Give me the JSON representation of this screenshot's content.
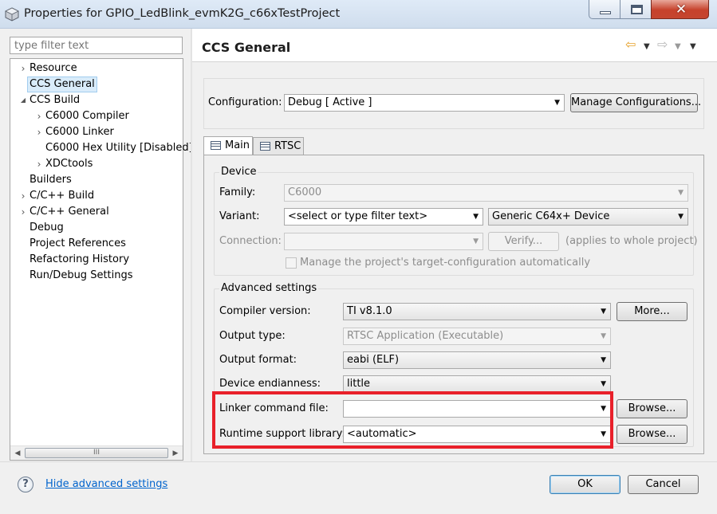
{
  "window": {
    "title": "Properties for GPIO_LedBlink_evmK2G_c66xTestProject",
    "minimize_glyph": "—",
    "maximize_glyph": "□",
    "close_glyph": "✕"
  },
  "filter": {
    "placeholder": "type filter text"
  },
  "tree": {
    "items": [
      {
        "label": "Resource",
        "expander": "›",
        "selected": false
      },
      {
        "label": "CCS General",
        "expander": "",
        "selected": true
      },
      {
        "label": "CCS Build",
        "expander": "◢",
        "selected": false
      },
      {
        "label": "C6000 Compiler",
        "expander": "›",
        "selected": false
      },
      {
        "label": "C6000 Linker",
        "expander": "›",
        "selected": false
      },
      {
        "label": "C6000 Hex Utility  [Disabled]",
        "expander": "",
        "selected": false
      },
      {
        "label": "XDCtools",
        "expander": "›",
        "selected": false
      },
      {
        "label": "Builders",
        "expander": "",
        "selected": false
      },
      {
        "label": "C/C++ Build",
        "expander": "›",
        "selected": false
      },
      {
        "label": "C/C++ General",
        "expander": "›",
        "selected": false
      },
      {
        "label": "Debug",
        "expander": "",
        "selected": false
      },
      {
        "label": "Project References",
        "expander": "",
        "selected": false
      },
      {
        "label": "Refactoring History",
        "expander": "",
        "selected": false
      },
      {
        "label": "Run/Debug Settings",
        "expander": "",
        "selected": false
      }
    ],
    "scroll_thumb_grip": "III",
    "scroll_left": "◀",
    "scroll_right": "▶"
  },
  "page": {
    "title": "CCS General",
    "nav_back": "⇦",
    "nav_forward": "⇨",
    "dropdown_glyph": "▼"
  },
  "configuration": {
    "label": "Configuration:",
    "value": "Debug  [ Active ]",
    "manage_button": "Manage Configurations..."
  },
  "tabs": [
    {
      "label": "Main",
      "active": true
    },
    {
      "label": "RTSC",
      "active": false
    }
  ],
  "device": {
    "group_title": "Device",
    "family_label": "Family:",
    "family_value": "C6000",
    "variant_label": "Variant:",
    "variant_filter": "<select or type filter text>",
    "variant_value": "Generic C64x+ Device",
    "connection_label": "Connection:",
    "connection_value": "",
    "verify_button": "Verify...",
    "applies_note": "(applies to whole project)",
    "manage_checkbox_label": "Manage the project's target-configuration automatically",
    "manage_checked": false
  },
  "advanced": {
    "group_title": "Advanced settings",
    "compiler_version_label": "Compiler version:",
    "compiler_version_value": "TI v8.1.0",
    "more_button": "More...",
    "output_type_label": "Output type:",
    "output_type_value": "RTSC Application (Executable)",
    "output_format_label": "Output format:",
    "output_format_value": "eabi (ELF)",
    "endianness_label": "Device endianness:",
    "endianness_value": "little",
    "linker_cmd_label": "Linker command file:",
    "linker_cmd_value": "",
    "runtime_lib_label": "Runtime support library:",
    "runtime_lib_value": "<automatic>",
    "browse_button": "Browse..."
  },
  "footer": {
    "help_glyph": "?",
    "hide_advanced_link": "Hide advanced settings",
    "ok_button": "OK",
    "cancel_button": "Cancel"
  },
  "colors": {
    "highlight": "#e8202a",
    "link": "#0063cd",
    "selection": "#d9ecfa"
  }
}
